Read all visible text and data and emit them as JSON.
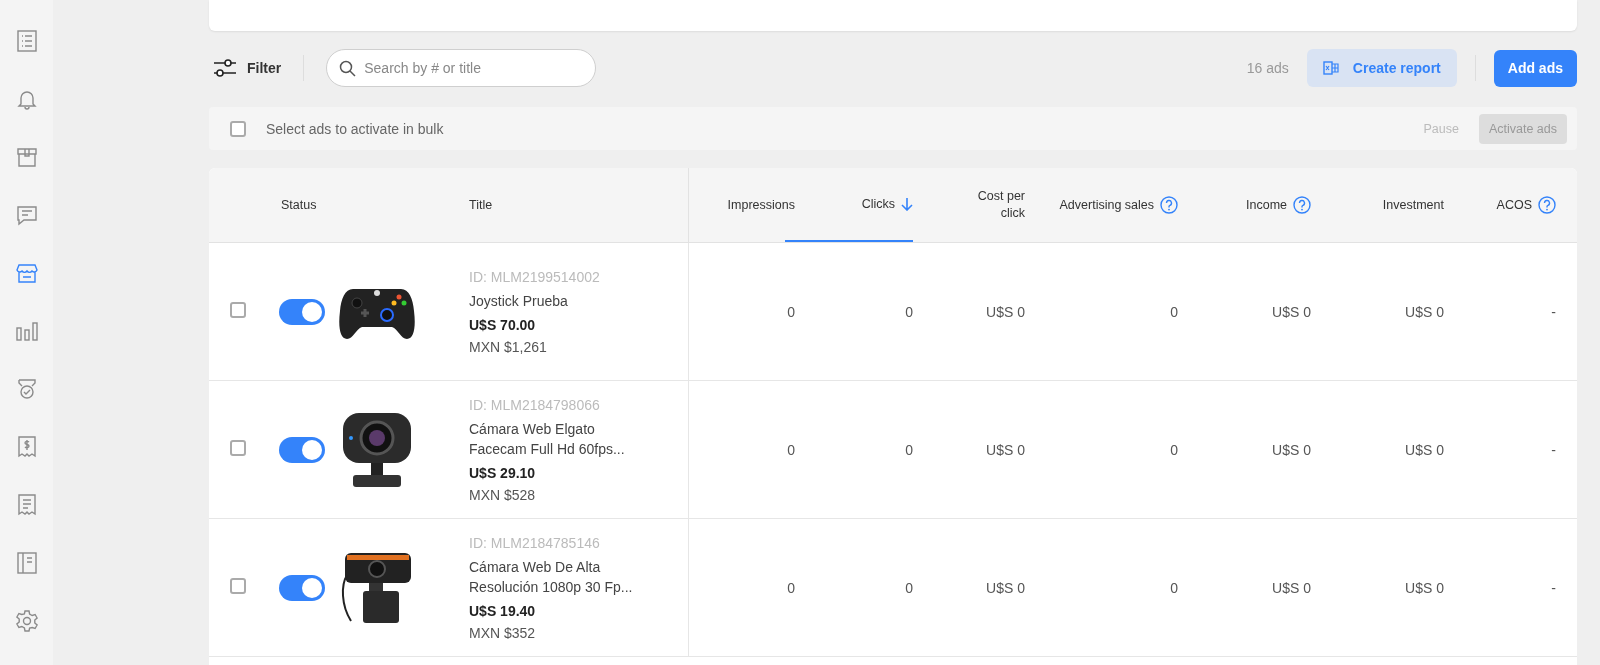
{
  "sidebar": {
    "items": [
      {
        "selected": false
      },
      {
        "selected": false
      },
      {
        "selected": false
      },
      {
        "selected": false
      },
      {
        "selected": true
      },
      {
        "selected": false
      },
      {
        "selected": false
      },
      {
        "selected": false
      },
      {
        "selected": false
      },
      {
        "selected": false
      },
      {
        "selected": false
      }
    ]
  },
  "toolbar": {
    "filter": "Filter",
    "search": {
      "placeholder": "Search by # or title"
    },
    "count": "16 ads",
    "create_report": "Create report",
    "add_ads": "Add ads"
  },
  "bulk_bar": {
    "checked": false,
    "label": "Select ads to activate in bulk",
    "pause": {
      "label": "Pause",
      "disabled": true
    },
    "activate": {
      "label": "Activate ads",
      "disabled": true
    }
  },
  "table": {
    "columns": [
      {
        "label": "Status",
        "help": false,
        "sorted": false
      },
      {
        "label": "Title",
        "help": false,
        "sorted": false
      },
      {
        "label": "Impressions",
        "help": false,
        "sorted": false
      },
      {
        "label": "Clicks",
        "help": false,
        "sorted": true
      },
      {
        "label": "Cost per click",
        "help": false,
        "sorted": false
      },
      {
        "label": "Advertising sales",
        "help": true,
        "sorted": false
      },
      {
        "label": "Income",
        "help": true,
        "sorted": false
      },
      {
        "label": "Investment",
        "help": false,
        "sorted": false
      },
      {
        "label": "ACOS",
        "help": true,
        "sorted": false
      }
    ],
    "rows": [
      {
        "selected": false,
        "active": true,
        "kind": "gamepad",
        "id": "ID: MLM2199514002",
        "title": "Joystick Prueba",
        "price_usd": "U$S 70.00",
        "price_mxn": "MXN $1,261",
        "impressions": "0",
        "clicks": "0",
        "cost_per_click": "U$S 0",
        "advertising_sales": "0",
        "income": "U$S 0",
        "investment": "U$S 0",
        "acos": "-"
      },
      {
        "selected": false,
        "active": true,
        "kind": "webcam",
        "id": "ID: MLM2184798066",
        "title": "Cámara Web Elgato Facecam Full Hd 60fps...",
        "price_usd": "U$S 29.10",
        "price_mxn": "MXN $528",
        "impressions": "0",
        "clicks": "0",
        "cost_per_click": "U$S 0",
        "advertising_sales": "0",
        "income": "U$S 0",
        "investment": "U$S 0",
        "acos": "-"
      },
      {
        "selected": false,
        "active": true,
        "kind": "clip_webcam",
        "id": "ID: MLM2184785146",
        "title": "Cámara Web De Alta Resolución 1080p 30 Fp...",
        "price_usd": "U$S 19.40",
        "price_mxn": "MXN $352",
        "impressions": "0",
        "clicks": "0",
        "cost_per_click": "U$S 0",
        "advertising_sales": "0",
        "income": "U$S 0",
        "investment": "U$S 0",
        "acos": "-"
      }
    ]
  }
}
